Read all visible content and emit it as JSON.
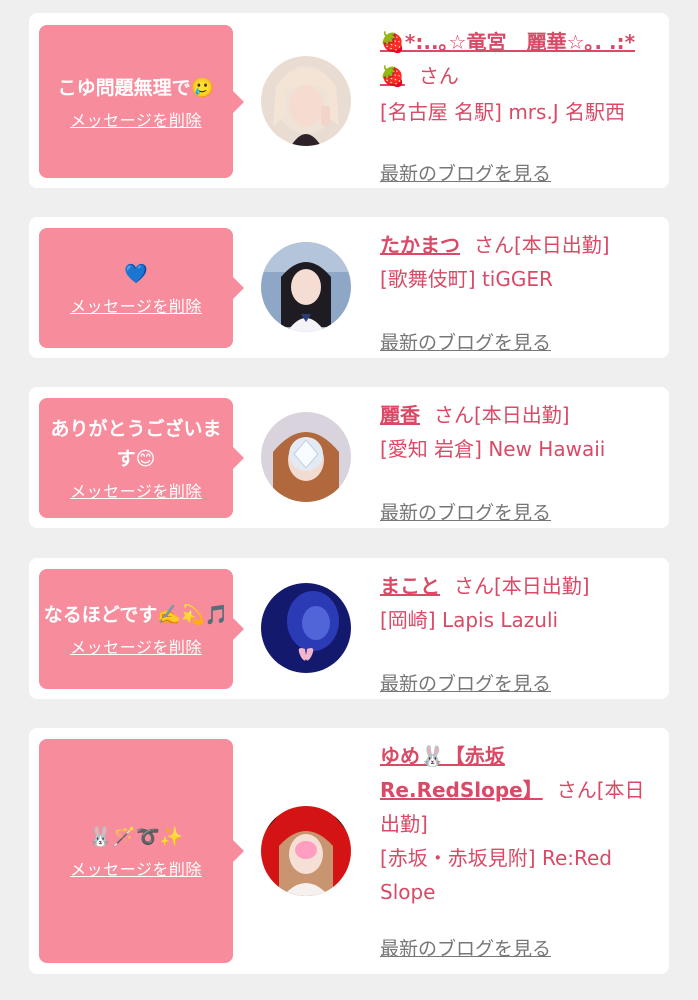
{
  "messages": [
    {
      "text": "こゆ問題無理で🥲",
      "delete_label": "メッセージを削除",
      "name": "🍓*:..｡☆竜宮　麗華☆｡. .:* 🍓",
      "honorific": "さん",
      "status": "",
      "store": "[名古屋 名駅] mrs.J 名駅西",
      "blog_label": "最新のブログを見る",
      "avatar": "avatar-pale-hair-peace-sign"
    },
    {
      "text": "💙",
      "delete_label": "メッセージを削除",
      "name": "たかまつ",
      "honorific": "さん",
      "status": "[本日出勤]",
      "store": "[歌舞伎町] tiGGER",
      "blog_label": "最新のブログを見る",
      "avatar": "avatar-dark-hair-uniform"
    },
    {
      "text": "ありがとうございます😊",
      "delete_label": "メッセージを削除",
      "name": "麗香",
      "honorific": "さん",
      "status": "[本日出勤]",
      "store": "[愛知 岩倉] New Hawaii",
      "blog_label": "最新のブログを見る",
      "avatar": "avatar-sparkle-face"
    },
    {
      "text": "なるほどです✍️💫🎵",
      "delete_label": "メッセージを削除",
      "name": "まこと",
      "honorific": "さん",
      "status": "[本日出勤]",
      "store": "[岡崎] Lapis Lazuli",
      "blog_label": "最新のブログを見る",
      "avatar": "avatar-blue-butterfly"
    },
    {
      "text": "🐰🪄➰✨",
      "delete_label": "メッセージを削除",
      "name": "ゆめ🐰【赤坂 Re.RedSlope】",
      "honorific": "さん",
      "status": "[本日出勤]",
      "store": "[赤坂・赤坂見附] Re:Red Slope",
      "blog_label": "最新のブログを見る",
      "avatar": "avatar-red-background"
    }
  ],
  "colors": {
    "accent": "#d84a66",
    "bubble": "#f68c9c",
    "background": "#efefef",
    "card": "#ffffff",
    "link_gray": "#777777"
  }
}
